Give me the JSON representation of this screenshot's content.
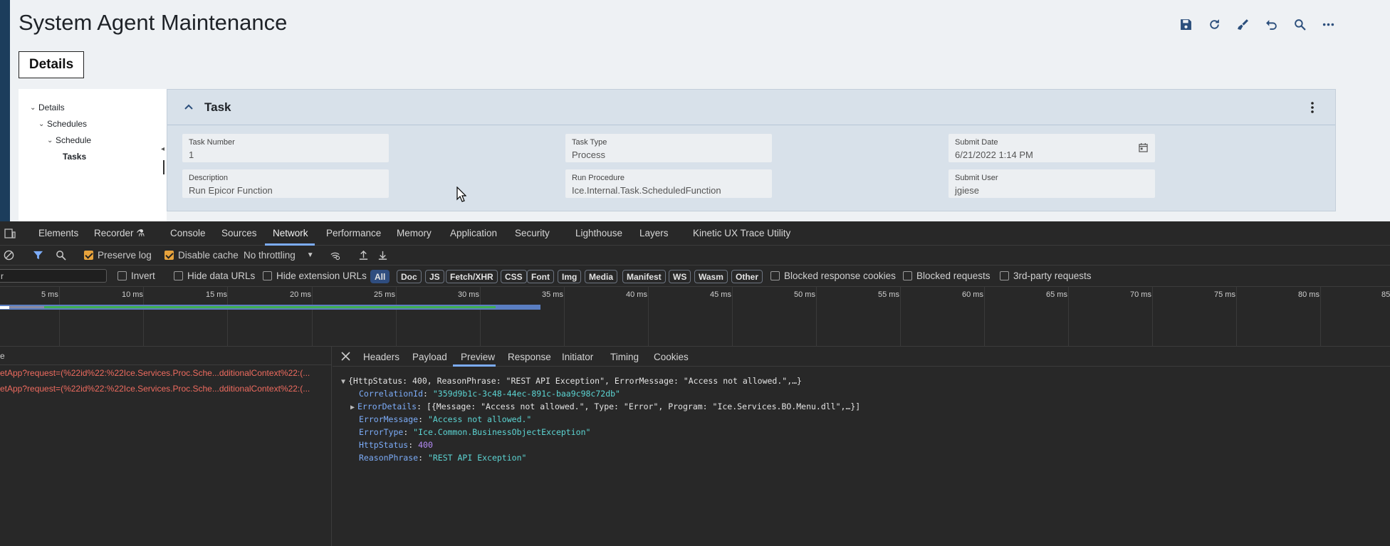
{
  "app": {
    "title": "System Agent Maintenance",
    "details_tab": "Details",
    "toolbar_icons": [
      "save-icon",
      "refresh-icon",
      "clear-icon",
      "undo-icon",
      "search-icon",
      "more-icon"
    ],
    "tree": [
      {
        "label": "Details",
        "level": 0
      },
      {
        "label": "Schedules",
        "level": 1
      },
      {
        "label": "Schedule",
        "level": 2
      },
      {
        "label": "Tasks",
        "level": 3
      }
    ],
    "task": {
      "title": "Task",
      "fields": {
        "task_number": {
          "label": "Task Number",
          "value": "1"
        },
        "task_type": {
          "label": "Task Type",
          "value": "Process"
        },
        "submit_date": {
          "label": "Submit Date",
          "value": "6/21/2022 1:14 PM"
        },
        "description": {
          "label": "Description",
          "value": "Run Epicor Function"
        },
        "run_procedure": {
          "label": "Run Procedure",
          "value": "Ice.Internal.Task.ScheduledFunction"
        },
        "submit_user": {
          "label": "Submit User",
          "value": "jgiese"
        }
      }
    }
  },
  "devtools": {
    "tabs": [
      "Elements",
      "Recorder",
      "Console",
      "Sources",
      "Network",
      "Performance",
      "Memory",
      "Application",
      "Security",
      "Lighthouse",
      "Layers",
      "Kinetic UX Trace Utility"
    ],
    "active_tab": "Network",
    "toolbar": {
      "preserve_log": "Preserve log",
      "disable_cache": "Disable cache",
      "throttling": "No throttling"
    },
    "filter": {
      "value": "r",
      "invert": "Invert",
      "hide_data_urls": "Hide data URLs",
      "hide_extension_urls": "Hide extension URLs",
      "types": [
        "All",
        "Doc",
        "JS",
        "Fetch/XHR",
        "CSS",
        "Font",
        "Img",
        "Media",
        "Manifest",
        "WS",
        "Wasm",
        "Other"
      ],
      "blocked_response_cookies": "Blocked response cookies",
      "blocked_requests": "Blocked requests",
      "third_party": "3rd-party requests"
    },
    "timeline_ticks": [
      "5 ms",
      "10 ms",
      "15 ms",
      "20 ms",
      "25 ms",
      "30 ms",
      "35 ms",
      "40 ms",
      "45 ms",
      "50 ms",
      "55 ms",
      "60 ms",
      "65 ms",
      "70 ms",
      "75 ms",
      "80 ms",
      "85"
    ],
    "requests": {
      "header": "e",
      "rows": [
        "etApp?request=(%22id%22:%22Ice.Services.Proc.Sche...dditionalContext%22:(...",
        "etApp?request=(%22id%22:%22Ice.Services.Proc.Sche...dditionalContext%22:(..."
      ]
    },
    "detail_tabs": [
      "Headers",
      "Payload",
      "Preview",
      "Response",
      "Initiator",
      "Timing",
      "Cookies"
    ],
    "active_detail_tab": "Preview",
    "preview": {
      "summary": "{HttpStatus: 400, ReasonPhrase: \"REST API Exception\", ErrorMessage: \"Access not allowed.\",…}",
      "correlation_key": "CorrelationId",
      "correlation_val": "\"359d9b1c-3c48-44ec-891c-baa9c98c72db\"",
      "error_details_key": "ErrorDetails",
      "error_details_val": "[{Message: \"Access not allowed.\", Type: \"Error\", Program: \"Ice.Services.BO.Menu.dll\",…}]",
      "error_message_key": "ErrorMessage",
      "error_message_val": "\"Access not allowed.\"",
      "error_type_key": "ErrorType",
      "error_type_val": "\"Ice.Common.BusinessObjectException\"",
      "http_status_key": "HttpStatus",
      "http_status_val": "400",
      "reason_phrase_key": "ReasonPhrase",
      "reason_phrase_val": "\"REST API Exception\""
    }
  }
}
